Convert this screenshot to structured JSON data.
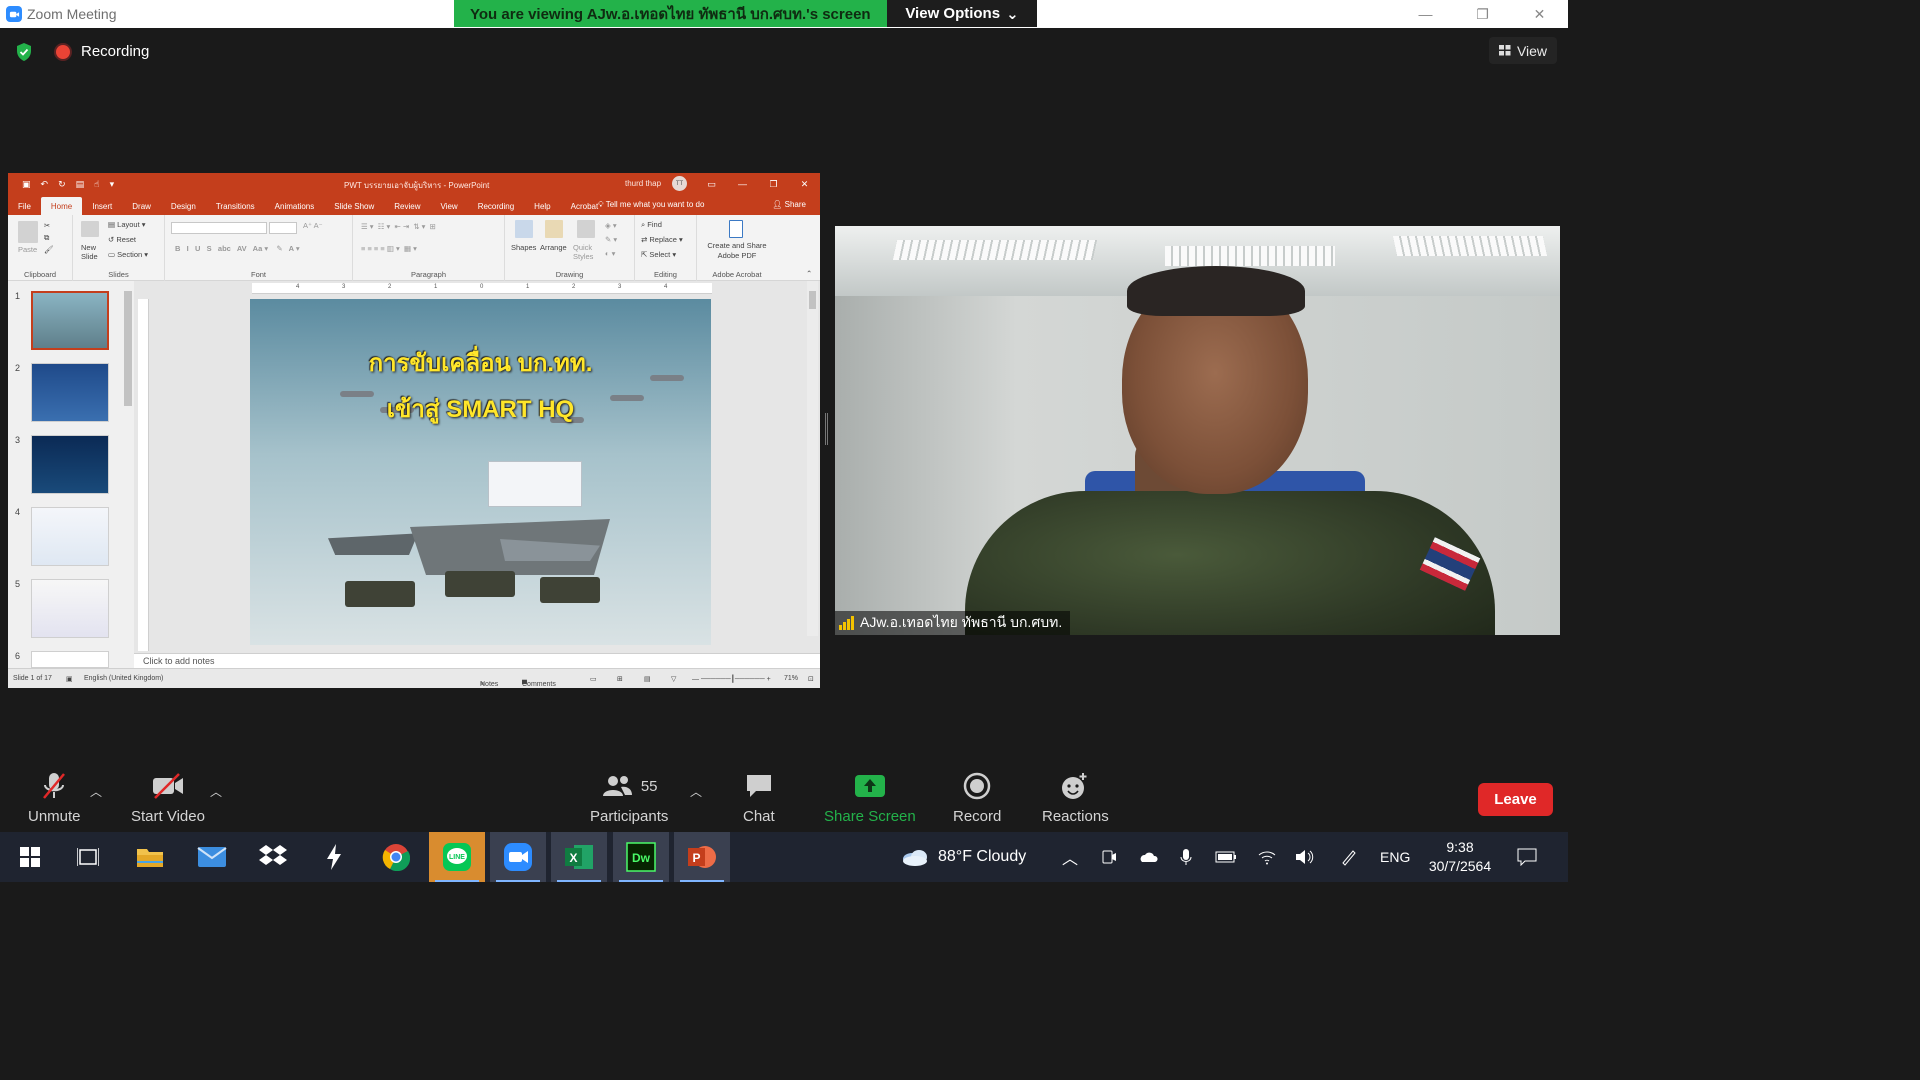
{
  "zoom": {
    "window_title": "Zoom Meeting",
    "banner_text": "You are viewing AJw.อ.เทอดไทย ทัพธานี บก.ศบท.'s screen",
    "view_options_label": "View Options",
    "recording_label": "Recording",
    "view_label": "View"
  },
  "ppt": {
    "doc_title": "PWT บรรยายเอาจับผู้บริหาร  -  PowerPoint",
    "user_name": "thurd thap",
    "user_initials": "TT",
    "tabs": [
      "File",
      "Home",
      "Insert",
      "Draw",
      "Design",
      "Transitions",
      "Animations",
      "Slide Show",
      "Review",
      "View",
      "Recording",
      "Help",
      "Acrobat"
    ],
    "tell_me": "Tell me what you want to do",
    "share_label": "Share",
    "ribbon": {
      "paste": "Paste",
      "new_slide": "New Slide",
      "layout": "Layout",
      "reset": "Reset",
      "section": "Section",
      "shapes": "Shapes",
      "arrange": "Arrange",
      "quick_styles": "Quick Styles",
      "find": "Find",
      "replace": "Replace",
      "select": "Select",
      "create_share_pdf": "Create and Share Adobe PDF",
      "groups": {
        "clipboard": "Clipboard",
        "slides": "Slides",
        "font": "Font",
        "paragraph": "Paragraph",
        "drawing": "Drawing",
        "editing": "Editing",
        "adobe_acrobat": "Adobe Acrobat"
      }
    },
    "thumb_numbers": [
      "1",
      "2",
      "3",
      "4",
      "5",
      "6"
    ],
    "ruler_ticks": [
      "4",
      "3",
      "2",
      "1",
      "0",
      "1",
      "2",
      "3",
      "4"
    ],
    "slide_title_line1": "การขับเคลื่อน บก.ทท.",
    "slide_title_line2": "เข้าสู่ SMART HQ",
    "notes_placeholder": "Click to add notes",
    "status": {
      "slide_count": "Slide 1 of 17",
      "language": "English (United Kingdom)",
      "notes": "Notes",
      "comments": "Comments",
      "zoom": "71%"
    }
  },
  "video": {
    "participant_name": "AJw.อ.เทอดไทย ทัพธานี  บก.ศบท."
  },
  "toolbar": {
    "unmute": "Unmute",
    "start_video": "Start Video",
    "participants": "Participants",
    "participant_count": "55",
    "chat": "Chat",
    "share_screen": "Share Screen",
    "record": "Record",
    "reactions": "Reactions",
    "leave": "Leave"
  },
  "taskbar": {
    "weather": "88°F  Cloudy",
    "language": "ENG",
    "time": "9:38",
    "date": "30/7/2564"
  },
  "colors": {
    "zoom_green": "#23b24a",
    "ppt_red": "#c43e1c",
    "leave_red": "#e02828",
    "slide_title_yellow": "#ffe62a"
  }
}
